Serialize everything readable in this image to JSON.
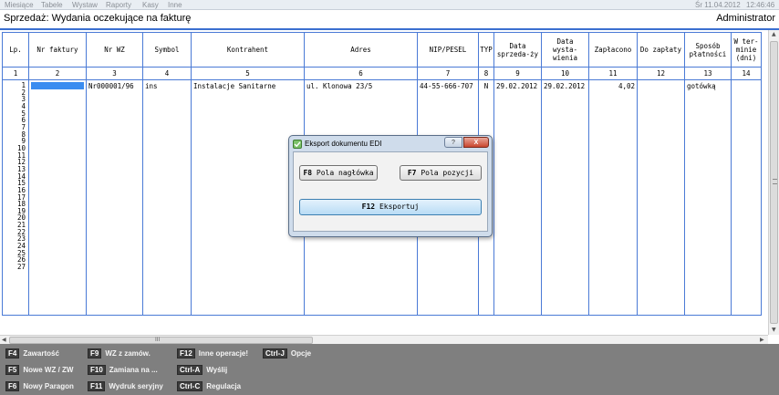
{
  "menu": {
    "items": [
      "Miesiące",
      "Tabele",
      "Wystaw",
      "Raporty",
      "Kasy",
      "Inne"
    ],
    "date": "Śr 11.04.2012",
    "time": "12:46:46"
  },
  "window": {
    "title": "Sprzedaż: Wydania oczekujące na fakturę",
    "user": "Administrator"
  },
  "grid": {
    "headers": [
      "Lp.",
      "Nr faktury",
      "Nr WZ",
      "Symbol",
      "Kontrahent",
      "Adres",
      "NIP/PESEL",
      "TYP",
      "Data sprzeda-ży",
      "Data wysta-wienia",
      "Zapłacono",
      "Do zapłaty",
      "Sposób płatności",
      "W ter-minie (dni)"
    ],
    "col_numbers": [
      "1",
      "2",
      "3",
      "4",
      "5",
      "6",
      "7",
      "8",
      "9",
      "10",
      "11",
      "12",
      "13",
      "14"
    ],
    "row_numbers": "1\n2\n3\n4\n5\n6\n7\n8\n9\n10\n11\n12\n13\n14\n15\n16\n17\n18\n19\n20\n21\n22\n23\n24\n25\n26\n27",
    "row1": {
      "nr_wz": "Nr000001/96",
      "symbol": "ins",
      "kontrahent": "Instalacje Sanitarne",
      "adres": "ul. Klonowa  23/5",
      "nip": "44-55-666-707",
      "typ": "N",
      "data_sprzedazy": "29.02.2012",
      "data_wystawienia": "29.02.2012",
      "zaplacono": "4,02",
      "sposob_platnosci": "gotówką"
    }
  },
  "scroll": {
    "h_mid": "III"
  },
  "fkeys": [
    {
      "key": "F4",
      "label": "Zawartość"
    },
    {
      "key": "F5",
      "label": "Nowe WZ / ZW"
    },
    {
      "key": "F6",
      "label": "Nowy Paragon"
    },
    {
      "key": "F9",
      "label": "WZ z zamów."
    },
    {
      "key": "F10",
      "label": "Zamiana na ..."
    },
    {
      "key": "F11",
      "label": "Wydruk seryjny"
    },
    {
      "key": "F12",
      "label": "Inne operacje!"
    },
    {
      "key": "Ctrl-A",
      "label": "Wyślij"
    },
    {
      "key": "Ctrl-C",
      "label": "Regulacja"
    },
    {
      "key": "Ctrl-J",
      "label": "Opcje"
    }
  ],
  "dialog": {
    "title": "Eksport dokumentu EDI",
    "help": "?",
    "close": "X",
    "btn_header_key": "F8",
    "btn_header_label": "Pola nagłówka",
    "btn_items_key": "F7",
    "btn_items_label": "Pola pozycji",
    "btn_export_key": "F12",
    "btn_export_label": "Eksportuj"
  },
  "colors": {
    "grid_line": "#4a7ad6",
    "selection": "#3a8cf0",
    "fbar_bg": "#7f7f7f",
    "close_btn": "#c9452e"
  }
}
